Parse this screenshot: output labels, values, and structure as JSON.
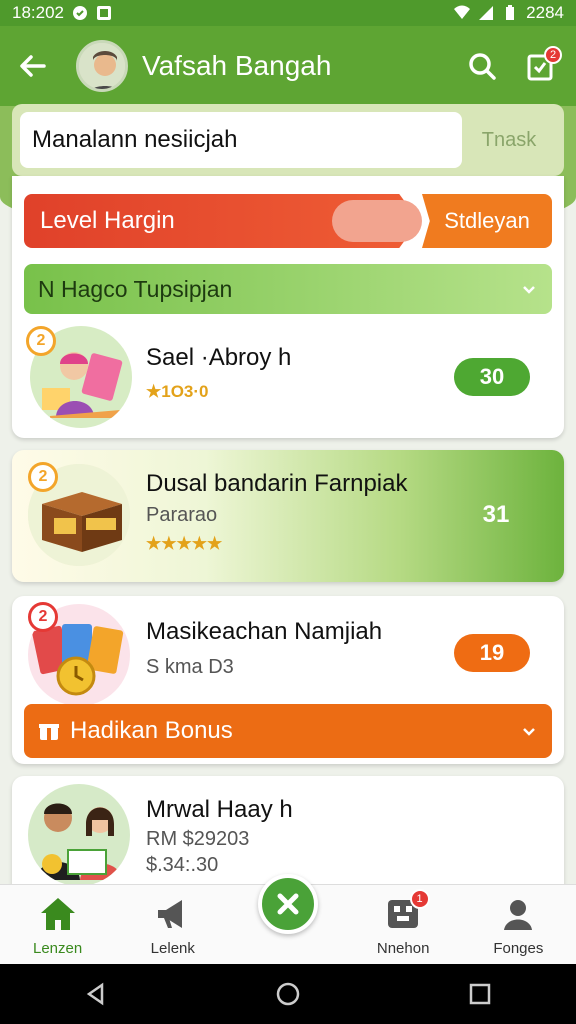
{
  "status_bar": {
    "time": "18:202",
    "right_text": "2284"
  },
  "app_bar": {
    "title": "Vafsah Bangah",
    "notification_count": "2"
  },
  "search": {
    "value": "Manalann nesiicjah",
    "button_label": "Tnask"
  },
  "level": {
    "label": "Level Hargin",
    "action_label": "Stdleyan"
  },
  "group": {
    "label": "N Hagco Tupsipjan"
  },
  "items": [
    {
      "title": "Sael ·Abroy h",
      "sub": "★1O3·0",
      "value": "30",
      "badge": "2",
      "value_color": "#4ea832"
    },
    {
      "title": "Dusal bandarin Farnpiak",
      "sub": "Pararao",
      "stars": "★★★★★",
      "value": "31",
      "badge": "2"
    },
    {
      "title": "Masikeachan Namjiah",
      "sub": "S kma D3",
      "value": "19",
      "badge": "2",
      "value_color": "#ef6c13"
    },
    {
      "title": "Mrwal Haay h",
      "sub": "RM $29203",
      "sub2": "$.34:.30"
    }
  ],
  "bonus": {
    "label": "Hadikan Bonus"
  },
  "bottom_nav": [
    {
      "label": "Lenzen",
      "icon": "home-icon"
    },
    {
      "label": "Lelenk",
      "icon": "megaphone-icon"
    },
    {
      "label": "",
      "icon": "close-icon"
    },
    {
      "label": "Nnehon",
      "icon": "gamepad-icon",
      "badge": "1"
    },
    {
      "label": "Fonges",
      "icon": "profile-icon"
    }
  ],
  "colors": {
    "primary_green": "#5ea533",
    "accent_orange": "#ef6c13",
    "accent_red": "#e0412a"
  }
}
